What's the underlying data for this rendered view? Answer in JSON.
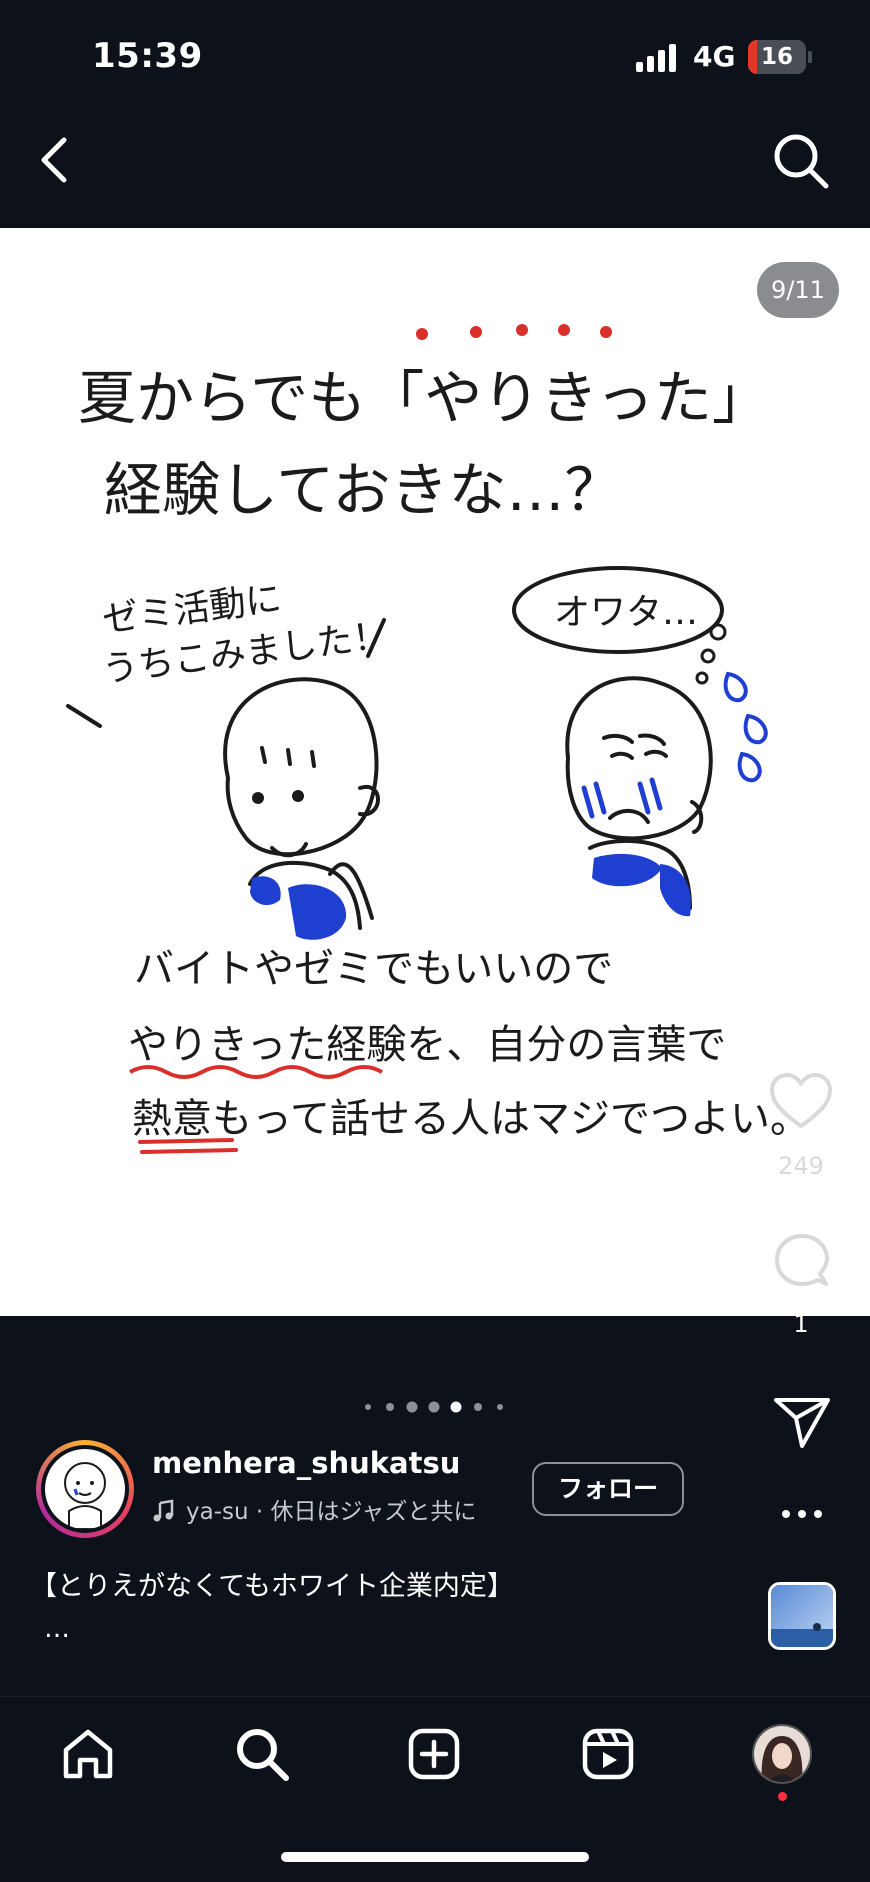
{
  "status_bar": {
    "time": "15:39",
    "network": "4G",
    "battery_level": "16",
    "battery_fraction": 0.16
  },
  "nav": {
    "back_icon": "chevron-left-icon",
    "search_icon": "search-icon"
  },
  "post": {
    "page_counter": "9/11",
    "illustration": {
      "title_line1_a": "夏からでも「",
      "title_line1_b": "やりきった",
      "title_line1_c": "」",
      "title_line2": "経験しておきな…？",
      "left_speech_line1": "ゼミ活動に",
      "left_speech_line2": "うちこみました！",
      "right_thought": "オワタ…",
      "bottom_line1": "バイトやゼミでもいいので",
      "bottom_line2_a": "やりきった経験",
      "bottom_line2_b": "を、自分の言葉で",
      "bottom_line3_a": "熱意",
      "bottom_line3_b": "もって話せる人はマジでつよい。"
    },
    "likes": "249",
    "comments": "1",
    "carousel": {
      "total": 11,
      "current": 9
    }
  },
  "author": {
    "username": "menhera_shukatsu",
    "music": "ya-su · 休日はジャズと共に",
    "follow_label": "フォロー"
  },
  "caption": {
    "text": "【とりえがなくてもホワイト企業内定】",
    "more": "…"
  },
  "colors": {
    "background": "#0d111a",
    "accent_red": "#d9302b",
    "drawing_blue": "#1f3fd0",
    "notification": "#ff3040"
  },
  "tabs": [
    {
      "icon": "home-icon"
    },
    {
      "icon": "search-icon"
    },
    {
      "icon": "create-icon"
    },
    {
      "icon": "reels-icon"
    },
    {
      "icon": "profile-avatar"
    }
  ]
}
